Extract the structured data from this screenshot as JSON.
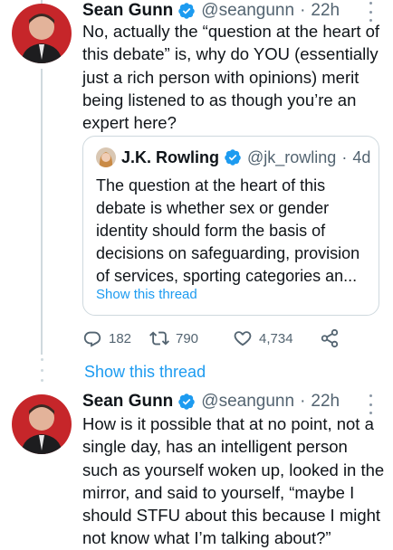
{
  "tweet1": {
    "name": "Sean Gunn",
    "handle": "@seangunn",
    "time": "22h",
    "text": "No, actually the “question at the heart of this debate” is, why do YOU (essentially just a rich person with opinions) merit being listened to as though you’re an expert here?"
  },
  "quote": {
    "name": "J.K. Rowling",
    "handle": "@jk_rowling",
    "time": "4d",
    "text": "The question at the heart of this debate is whether sex or gender identity should form the basis of decisions on safeguarding, provision of services, sporting categories an...",
    "show_thread": "Show this thread"
  },
  "actions": {
    "replies": "182",
    "retweets": "790",
    "likes": "4,734"
  },
  "show_thread": "Show this thread",
  "tweet2": {
    "name": "Sean Gunn",
    "handle": "@seangunn",
    "time": "22h",
    "text": "How is it possible that at no point, not a single day, has an intelligent person such as yourself woken up, looked in the mirror, and said to yourself, “maybe I should STFU about this because I might not know what I’m talking about?”"
  },
  "icons": {
    "verified": "verified-badge-icon",
    "reply": "reply-icon",
    "retweet": "retweet-icon",
    "like": "heart-icon",
    "share": "share-icon",
    "more": "more-dots-icon"
  },
  "colors": {
    "link": "#1d9bf0",
    "muted": "#536471",
    "border": "#cfd9de",
    "text": "#0f1419"
  }
}
